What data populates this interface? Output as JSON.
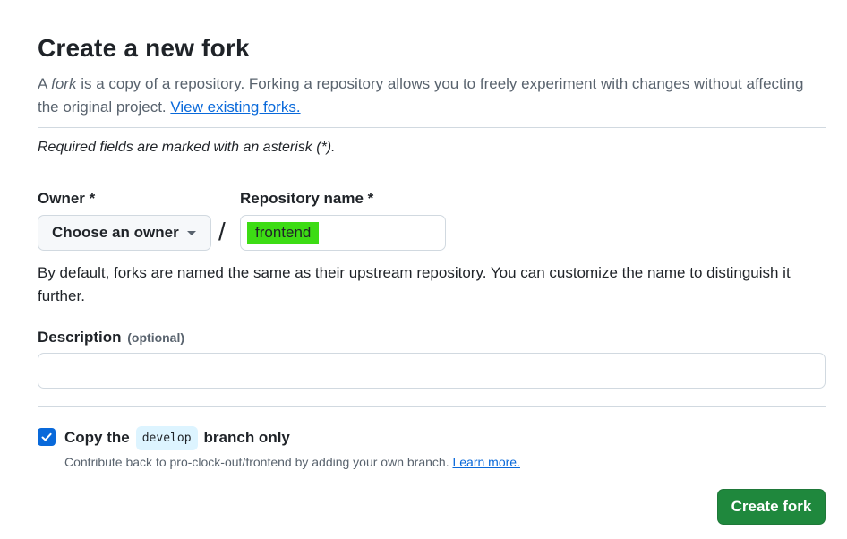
{
  "page": {
    "title": "Create a new fork",
    "subtitle_prefix": "A ",
    "subtitle_fork_word": "fork",
    "subtitle_text": " is a copy of a repository. Forking a repository allows you to freely experiment with changes without affecting the original project. ",
    "view_forks_link": "View existing forks.",
    "required_note": "Required fields are marked with an asterisk (*)."
  },
  "form": {
    "owner": {
      "label": "Owner *",
      "selected": "Choose an owner"
    },
    "separator": "/",
    "repository_name": {
      "label": "Repository name *",
      "value": "frontend",
      "highlight_color": "#3ddc14"
    },
    "name_help": "By default, forks are named the same as their upstream repository. You can customize the name to distinguish it further.",
    "description": {
      "label": "Description",
      "optional_tag": "(optional)",
      "value": ""
    },
    "copy_branch": {
      "checked": true,
      "label_prefix": "Copy the",
      "branch_name": "develop",
      "label_suffix": "branch only",
      "help_text": "Contribute back to pro-clock-out/frontend by adding your own branch.",
      "learn_more": "Learn more."
    },
    "submit_label": "Create fork"
  },
  "colors": {
    "accent_blue": "#0969da",
    "primary_green": "#1f883d"
  },
  "icons": {
    "owner_dropdown": "triangle-down-icon",
    "checkbox": "check-icon"
  }
}
